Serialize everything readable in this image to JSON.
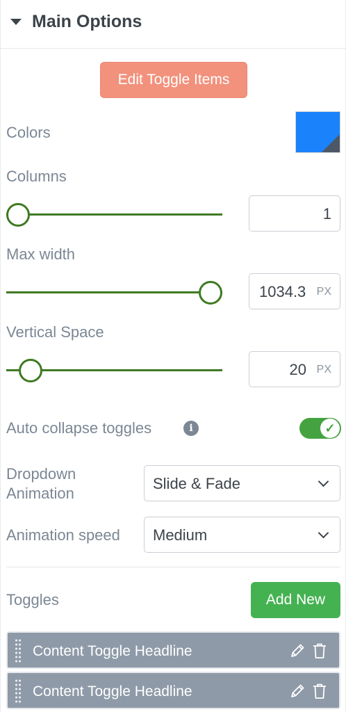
{
  "header": {
    "title": "Main Options"
  },
  "edit_button": {
    "label": "Edit Toggle Items"
  },
  "colors": {
    "label": "Colors",
    "swatch_color": "#1a82fb"
  },
  "columns": {
    "label": "Columns",
    "value": "1",
    "slider_level": 0
  },
  "max_width": {
    "label": "Max width",
    "value": "1034.3",
    "unit": "PX",
    "slider_level": 1
  },
  "vertical_space": {
    "label": "Vertical Space",
    "value": "20",
    "unit": "PX",
    "slider_level": 0.1
  },
  "auto_collapse": {
    "label": "Auto collapse toggles",
    "info_icon": "info-icon",
    "enabled": true
  },
  "dropdown_animation": {
    "label_line1": "Dropdown",
    "label_line2": "Animation",
    "value": "Slide & Fade"
  },
  "animation_speed": {
    "label": "Animation speed",
    "value": "Medium"
  },
  "toggles": {
    "label": "Toggles",
    "add_button": "Add New",
    "items": [
      {
        "label": "Content Toggle Headline"
      },
      {
        "label": "Content Toggle Headline"
      }
    ]
  },
  "colors_theme": {
    "accent_green": "#44a340",
    "slider_green": "#3e7a22",
    "edit_button_bg": "#f2917c",
    "item_bg": "#8e9aa8"
  }
}
